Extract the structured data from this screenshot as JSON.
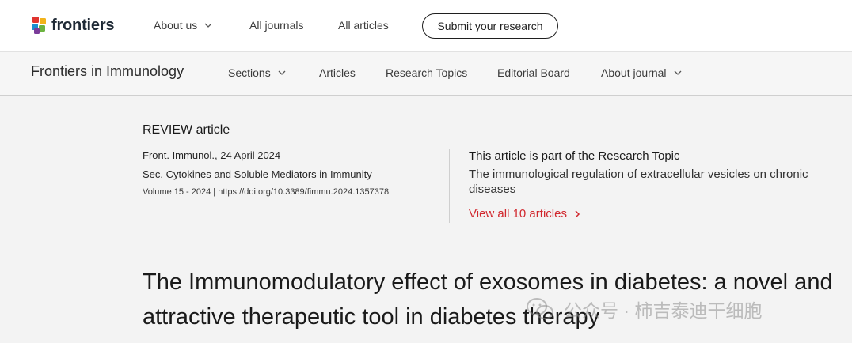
{
  "header": {
    "logo_text": "frontiers",
    "nav": [
      "About us",
      "All journals",
      "All articles"
    ],
    "submit_label": "Submit your research"
  },
  "journal_bar": {
    "name": "Frontiers in Immunology",
    "nav": [
      "Sections",
      "Articles",
      "Research Topics",
      "Editorial Board",
      "About journal"
    ]
  },
  "article": {
    "type": "REVIEW article",
    "citation_line": "Front. Immunol., 24 April 2024",
    "section_line": "Sec. Cytokines and Soluble Mediators in Immunity",
    "volume_line": "Volume 15 - 2024 | https://doi.org/10.3389/fimmu.2024.1357378",
    "title": "The Immunomodulatory effect of exosomes in diabetes: a novel and attractive therapeutic tool in diabetes therapy"
  },
  "research_topic": {
    "heading": "This article is part of the Research Topic",
    "name": "The immunological regulation of extracellular vesicles on chronic diseases",
    "view_all": "View all 10 articles"
  },
  "watermark": {
    "text": "公众号 · 柿吉泰迪干细胞"
  },
  "colors": {
    "accent_red": "#d1282e",
    "background": "#f3f3f3"
  }
}
